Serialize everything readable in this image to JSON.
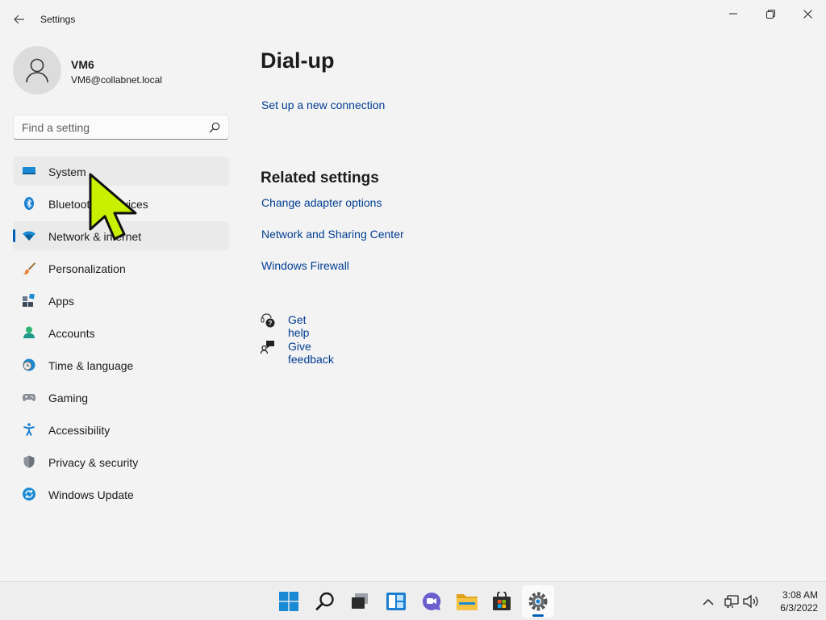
{
  "window": {
    "title": "Settings"
  },
  "profile": {
    "name": "VM6",
    "email": "VM6@collabnet.local"
  },
  "search": {
    "placeholder": "Find a setting"
  },
  "sidebar": {
    "items": [
      {
        "label": "System",
        "icon": "system-icon"
      },
      {
        "label": "Bluetooth & devices",
        "icon": "bluetooth-icon"
      },
      {
        "label": "Network & internet",
        "icon": "wifi-icon",
        "selected": true
      },
      {
        "label": "Personalization",
        "icon": "brush-icon"
      },
      {
        "label": "Apps",
        "icon": "apps-icon"
      },
      {
        "label": "Accounts",
        "icon": "accounts-icon"
      },
      {
        "label": "Time & language",
        "icon": "clock-globe-icon"
      },
      {
        "label": "Gaming",
        "icon": "gamepad-icon"
      },
      {
        "label": "Accessibility",
        "icon": "accessibility-icon"
      },
      {
        "label": "Privacy & security",
        "icon": "shield-icon"
      },
      {
        "label": "Windows Update",
        "icon": "update-icon"
      }
    ]
  },
  "main": {
    "title": "Dial-up",
    "setup_link": "Set up a new connection",
    "related": {
      "title": "Related settings",
      "links": [
        "Change adapter options",
        "Network and Sharing Center",
        "Windows Firewall"
      ]
    },
    "help": {
      "get_help": "Get help",
      "give_feedback": "Give feedback"
    }
  },
  "taskbar": {
    "apps": [
      "start-icon",
      "search-icon",
      "task-view-icon",
      "widgets-icon",
      "chat-icon",
      "file-explorer-icon",
      "store-icon",
      "settings-icon"
    ],
    "time": "3:08 AM",
    "date": "6/3/2022"
  },
  "colors": {
    "accent": "#005fb8",
    "link": "#003e92",
    "background": "#f3f3f3",
    "cursor": "#c8f000"
  }
}
